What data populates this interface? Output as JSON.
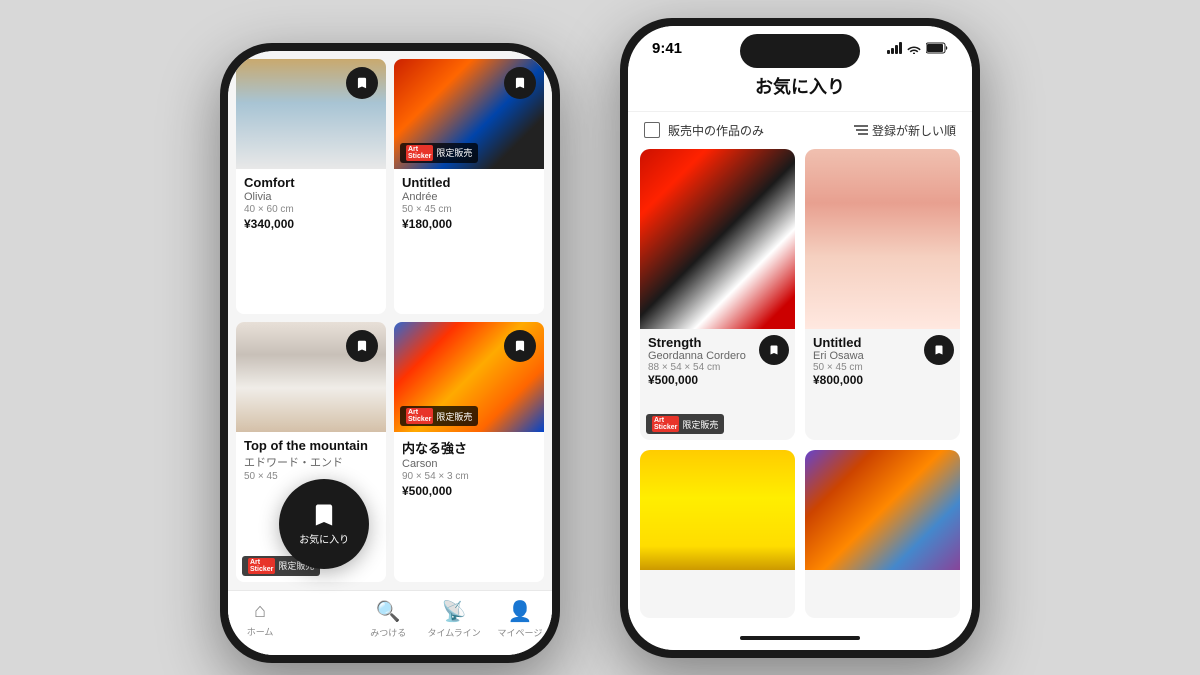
{
  "scene": {
    "background": "#d8d8d8"
  },
  "phone1": {
    "cards": [
      {
        "title": "Comfort",
        "artist": "Olivia",
        "size": "40 × 60 cm",
        "price": "¥340,000",
        "has_badge": false,
        "image_type": "comfort"
      },
      {
        "title": "Untitled",
        "artist": "Andrée",
        "size": "50 × 45 cm",
        "price": "¥180,000",
        "has_badge": true,
        "image_type": "untitled-top"
      },
      {
        "title": "Top of the mountain",
        "artist": "エドワード・エンド",
        "size": "50 × 45",
        "price": "¥...",
        "has_badge": true,
        "image_type": "mountain"
      },
      {
        "title": "内なる強さ",
        "artist": "Carson",
        "size": "90 × 54 × 3 cm",
        "price": "¥500,000",
        "has_badge": true,
        "image_type": "inner"
      }
    ],
    "nav": {
      "items": [
        {
          "label": "ホーム",
          "icon": "home"
        },
        {
          "label": "お気に入り",
          "icon": "bookmark",
          "active": true
        },
        {
          "label": "みつける",
          "icon": "search"
        },
        {
          "label": "タイムライン",
          "icon": "cast"
        },
        {
          "label": "マイページ",
          "icon": "user"
        }
      ]
    },
    "floating": {
      "label": "お気に入り"
    }
  },
  "phone2": {
    "status": {
      "time": "9:41",
      "signal": "●●●●",
      "wifi": "wifi",
      "battery": "battery"
    },
    "header": {
      "title": "お気に入り"
    },
    "filter": {
      "checkbox_label": "販売中の作品のみ",
      "sort_label": "登録が新しい順"
    },
    "cards": [
      {
        "title": "Strength",
        "artist": "Geordanna Cordero",
        "size": "88 × 54 × 54 cm",
        "price": "¥500,000",
        "has_badge": true,
        "image_type": "strength"
      },
      {
        "title": "Untitled",
        "artist": "Eri Osawa",
        "size": "50 × 45 cm",
        "price": "¥800,000",
        "has_badge": false,
        "image_type": "untitled-pink"
      },
      {
        "title": "",
        "artist": "",
        "size": "",
        "price": "",
        "has_badge": false,
        "image_type": "yellow"
      },
      {
        "title": "",
        "artist": "",
        "size": "",
        "price": "",
        "has_badge": false,
        "image_type": "colorful"
      }
    ],
    "limited_badge": "限定販売",
    "art_sticker": "Art Sticker"
  }
}
